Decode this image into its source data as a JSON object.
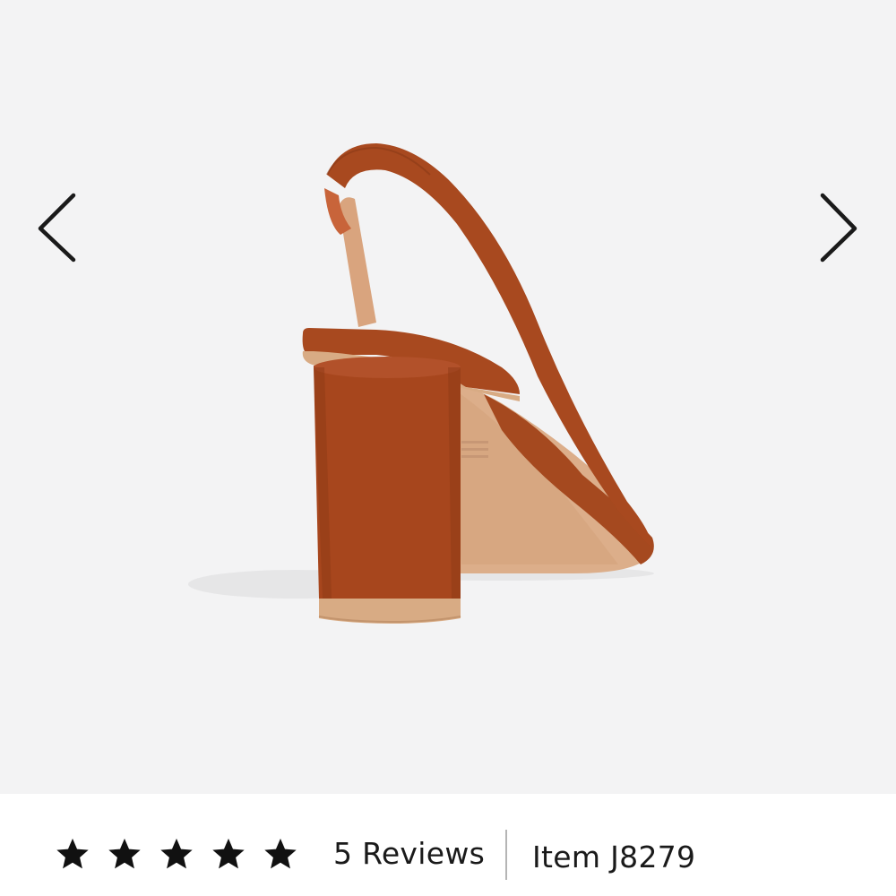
{
  "gallery": {
    "image_subject": "rust suede slingback block-heel shoe, rear view",
    "prev_icon": "chevron-left-icon",
    "next_icon": "chevron-right-icon",
    "colors": {
      "background": "#f3f3f4",
      "suede": "#a5491f",
      "lining": "#d9a47e",
      "heel_base": "#d8ab84",
      "arrow": "#1a1a1a"
    }
  },
  "rating": {
    "stars": 5,
    "star_icon": "star-icon",
    "star_color": "#111111"
  },
  "reviews_label": "5 Reviews",
  "item_label": "Item J8279"
}
